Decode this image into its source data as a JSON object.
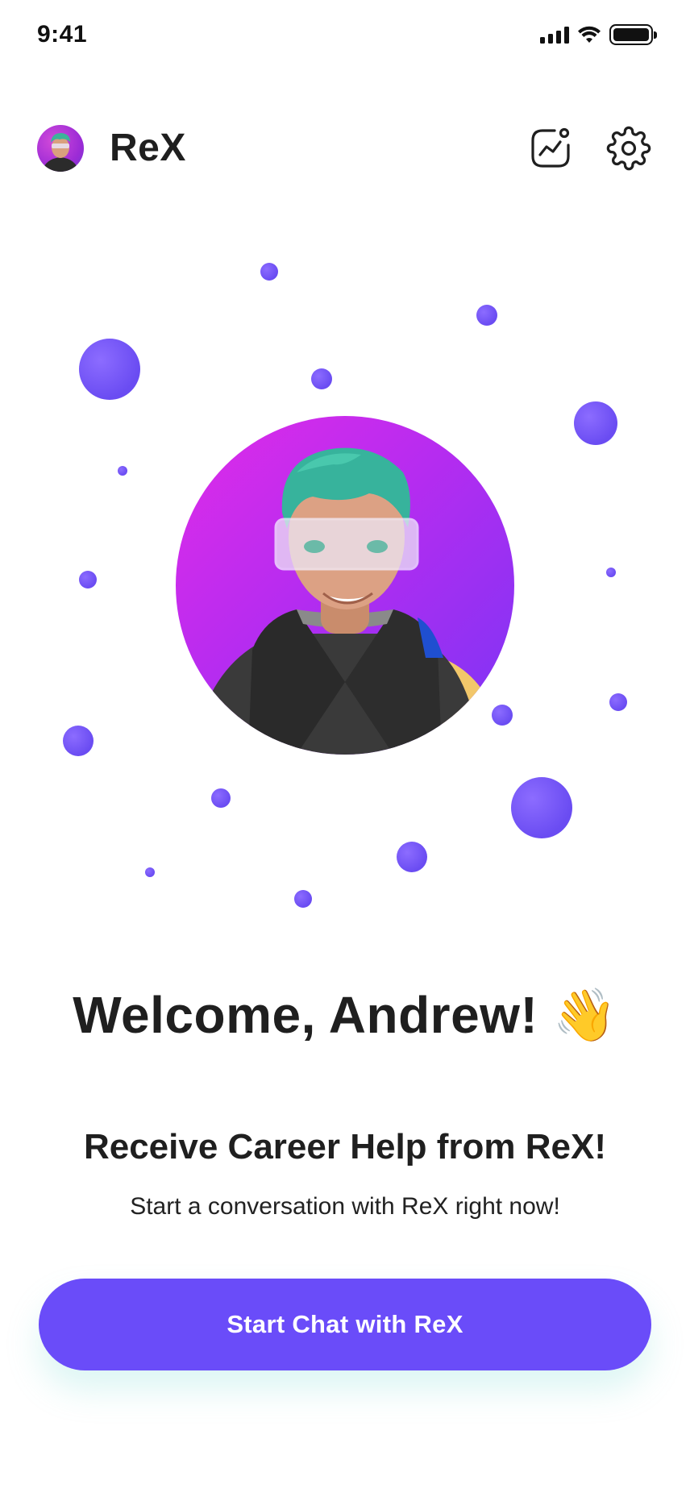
{
  "status_bar": {
    "time": "9:41"
  },
  "header": {
    "title": "ReX",
    "insights_icon": "activity-chart-icon",
    "settings_icon": "gear-icon"
  },
  "hero": {
    "avatar_icon": "rex-avatar"
  },
  "welcome": {
    "text": "Welcome, Andrew! 👋"
  },
  "intro": {
    "heading": "Receive Career Help from ReX!",
    "description": "Start a conversation with ReX right now!"
  },
  "cta": {
    "label": "Start Chat with ReX"
  },
  "colors": {
    "accent": "#6a4cf9",
    "dot": "#7a5cf7",
    "gradient_start": "#e12be8",
    "gradient_end": "#7a35f5"
  }
}
